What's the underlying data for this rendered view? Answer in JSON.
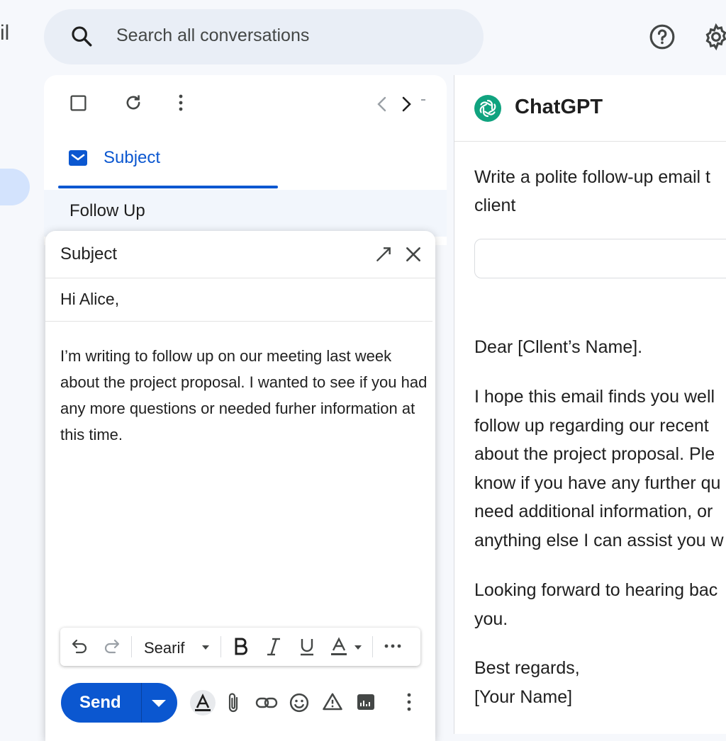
{
  "app": {
    "logo_text": "il"
  },
  "search": {
    "placeholder": "Search all conversations"
  },
  "mail_list": {
    "tab_label": "Subject",
    "row_label": "Follow Up"
  },
  "compose": {
    "title": "Subject",
    "greeting": "Hi Alice,",
    "body": "I’m writing to follow up on our meeting last week about the project proposal. I wanted to see if you had any more questions or needed furher information at this time.",
    "font_name": "Searif",
    "send_label": "Send"
  },
  "chatgpt": {
    "title": "ChatGPT",
    "prompt_line1": "Write a polite follow-up email t",
    "prompt_line2": "client",
    "response": {
      "salutation": "Dear [Cllent’s Name].",
      "para1_lines": [
        "I hope this email finds you well",
        "follow up regarding our recent",
        "about the project proposal. Ple",
        "know if you have any further qu",
        "need additional information, or",
        "anything else I can assist you w"
      ],
      "para2_lines": [
        "Looking forward to hearing bac",
        "you."
      ],
      "closing": "Best regards,",
      "signature": "[Your Name]"
    }
  },
  "colors": {
    "accent": "#0b57d0",
    "background": "#f6f8fc",
    "search_bg": "#e9eef6",
    "chatgpt_logo": "#10a37f"
  },
  "icons": {
    "search": "search-icon",
    "help": "help-icon",
    "settings": "gear-icon",
    "select": "checkbox-icon",
    "refresh": "refresh-icon",
    "more": "more-vert-icon",
    "prev": "chevron-left-icon",
    "next": "chevron-right-icon",
    "expand": "expand-icon",
    "close": "close-icon",
    "undo": "undo-icon",
    "redo": "redo-icon",
    "bold": "bold-icon",
    "italic": "italic-icon",
    "underline": "underline-icon",
    "text_color": "text-color-icon",
    "formatting": "formatting-icon",
    "attach": "attach-icon",
    "link": "link-icon",
    "emoji": "emoji-icon",
    "confidential": "warning-icon",
    "photo": "photo-icon"
  }
}
